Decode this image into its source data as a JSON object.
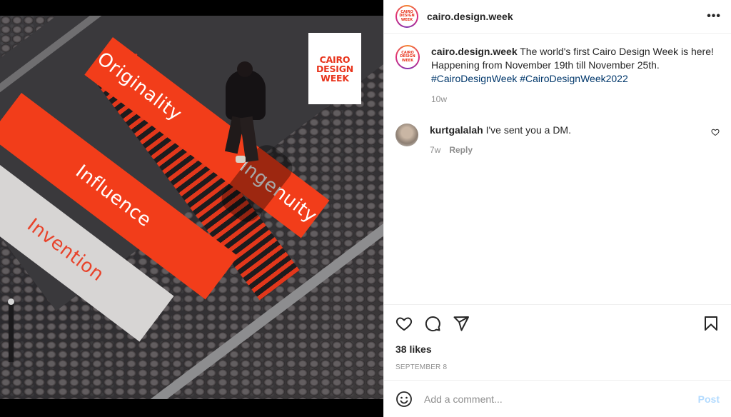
{
  "post": {
    "author": "cairo.design.week",
    "logo_lines": [
      "CAIRO",
      "DESIGN",
      "WEEK"
    ],
    "image": {
      "stripe_words": [
        "Originality",
        "Ingenuity",
        "Influence",
        "Invention"
      ]
    }
  },
  "header": {
    "username": "cairo.design.week",
    "more_label": "•••"
  },
  "caption": {
    "username": "cairo.design.week",
    "text": "The world's first Cairo Design Week is here! Happening from November 19th till November 25th.",
    "hashtags": [
      "#CairoDesignWeek",
      "#CairoDesignWeek2022"
    ],
    "age": "10w"
  },
  "comments": [
    {
      "username": "kurtgalalah",
      "text": "I've sent you a DM.",
      "age": "7w",
      "reply_label": "Reply"
    }
  ],
  "actions": {
    "likes": "38 likes",
    "date": "SEPTEMBER 8"
  },
  "add_comment": {
    "placeholder": "Add a comment...",
    "post_label": "Post"
  },
  "icons": {
    "more": "more-options-icon",
    "like": "heart-icon",
    "comment": "comment-icon",
    "share": "share-icon",
    "save": "bookmark-icon",
    "emoji": "emoji-icon",
    "comment_like": "heart-icon"
  },
  "colors": {
    "brand_red": "#f23d1a",
    "link_blue": "#00376b",
    "post_button": "#b3dbff",
    "muted_text": "#8e8e8e"
  }
}
